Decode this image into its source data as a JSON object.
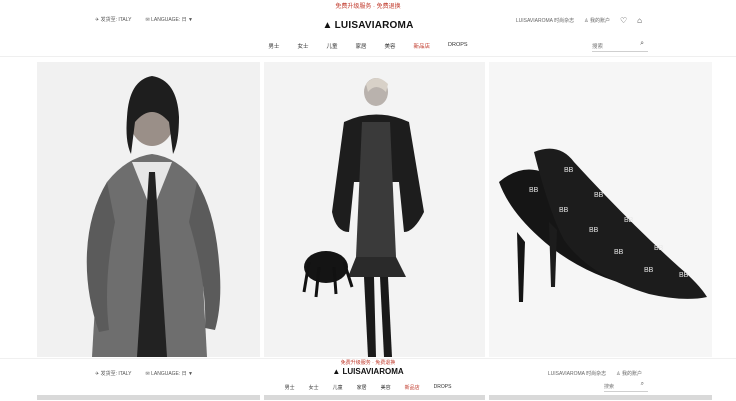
{
  "promo": "免费升级服务 · 免费退换",
  "topbar": {
    "ship_to": "✈ 发货至: ITALY",
    "language": "✉ LANGUAGE: 日 ▼",
    "magazine": "LUISAVIAROMA 时尚杂志",
    "account": "♙ 我的账户",
    "wishlist_icon": "♡",
    "bag_icon": "⌂"
  },
  "logo": {
    "mark": "▲",
    "text": "LUISAVIAROMA"
  },
  "nav": {
    "items": [
      "男士",
      "女士",
      "儿童",
      "家居",
      "美容",
      "新品店",
      "DROPS"
    ]
  },
  "search": {
    "placeholder": "搜索",
    "icon": "⌕"
  },
  "sticky": {
    "promo": "免费升级服务 · 免费退换",
    "ship_to": "✈ 发货至: ITALY",
    "language": "✉ LANGUAGE: 日 ▼",
    "logo": "▲ LUISAVIAROMA",
    "magazine": "LUISAVIAROMA 时尚杂志",
    "account": "♙ 我的账户",
    "nav_items": [
      "男士",
      "女士",
      "儿童",
      "家居",
      "美容",
      "新品店",
      "DROPS"
    ],
    "search_placeholder": "搜索",
    "search_icon": "⌕"
  },
  "colors": {
    "sale": "#c0392b",
    "text": "#222222",
    "accent": "#111111"
  }
}
